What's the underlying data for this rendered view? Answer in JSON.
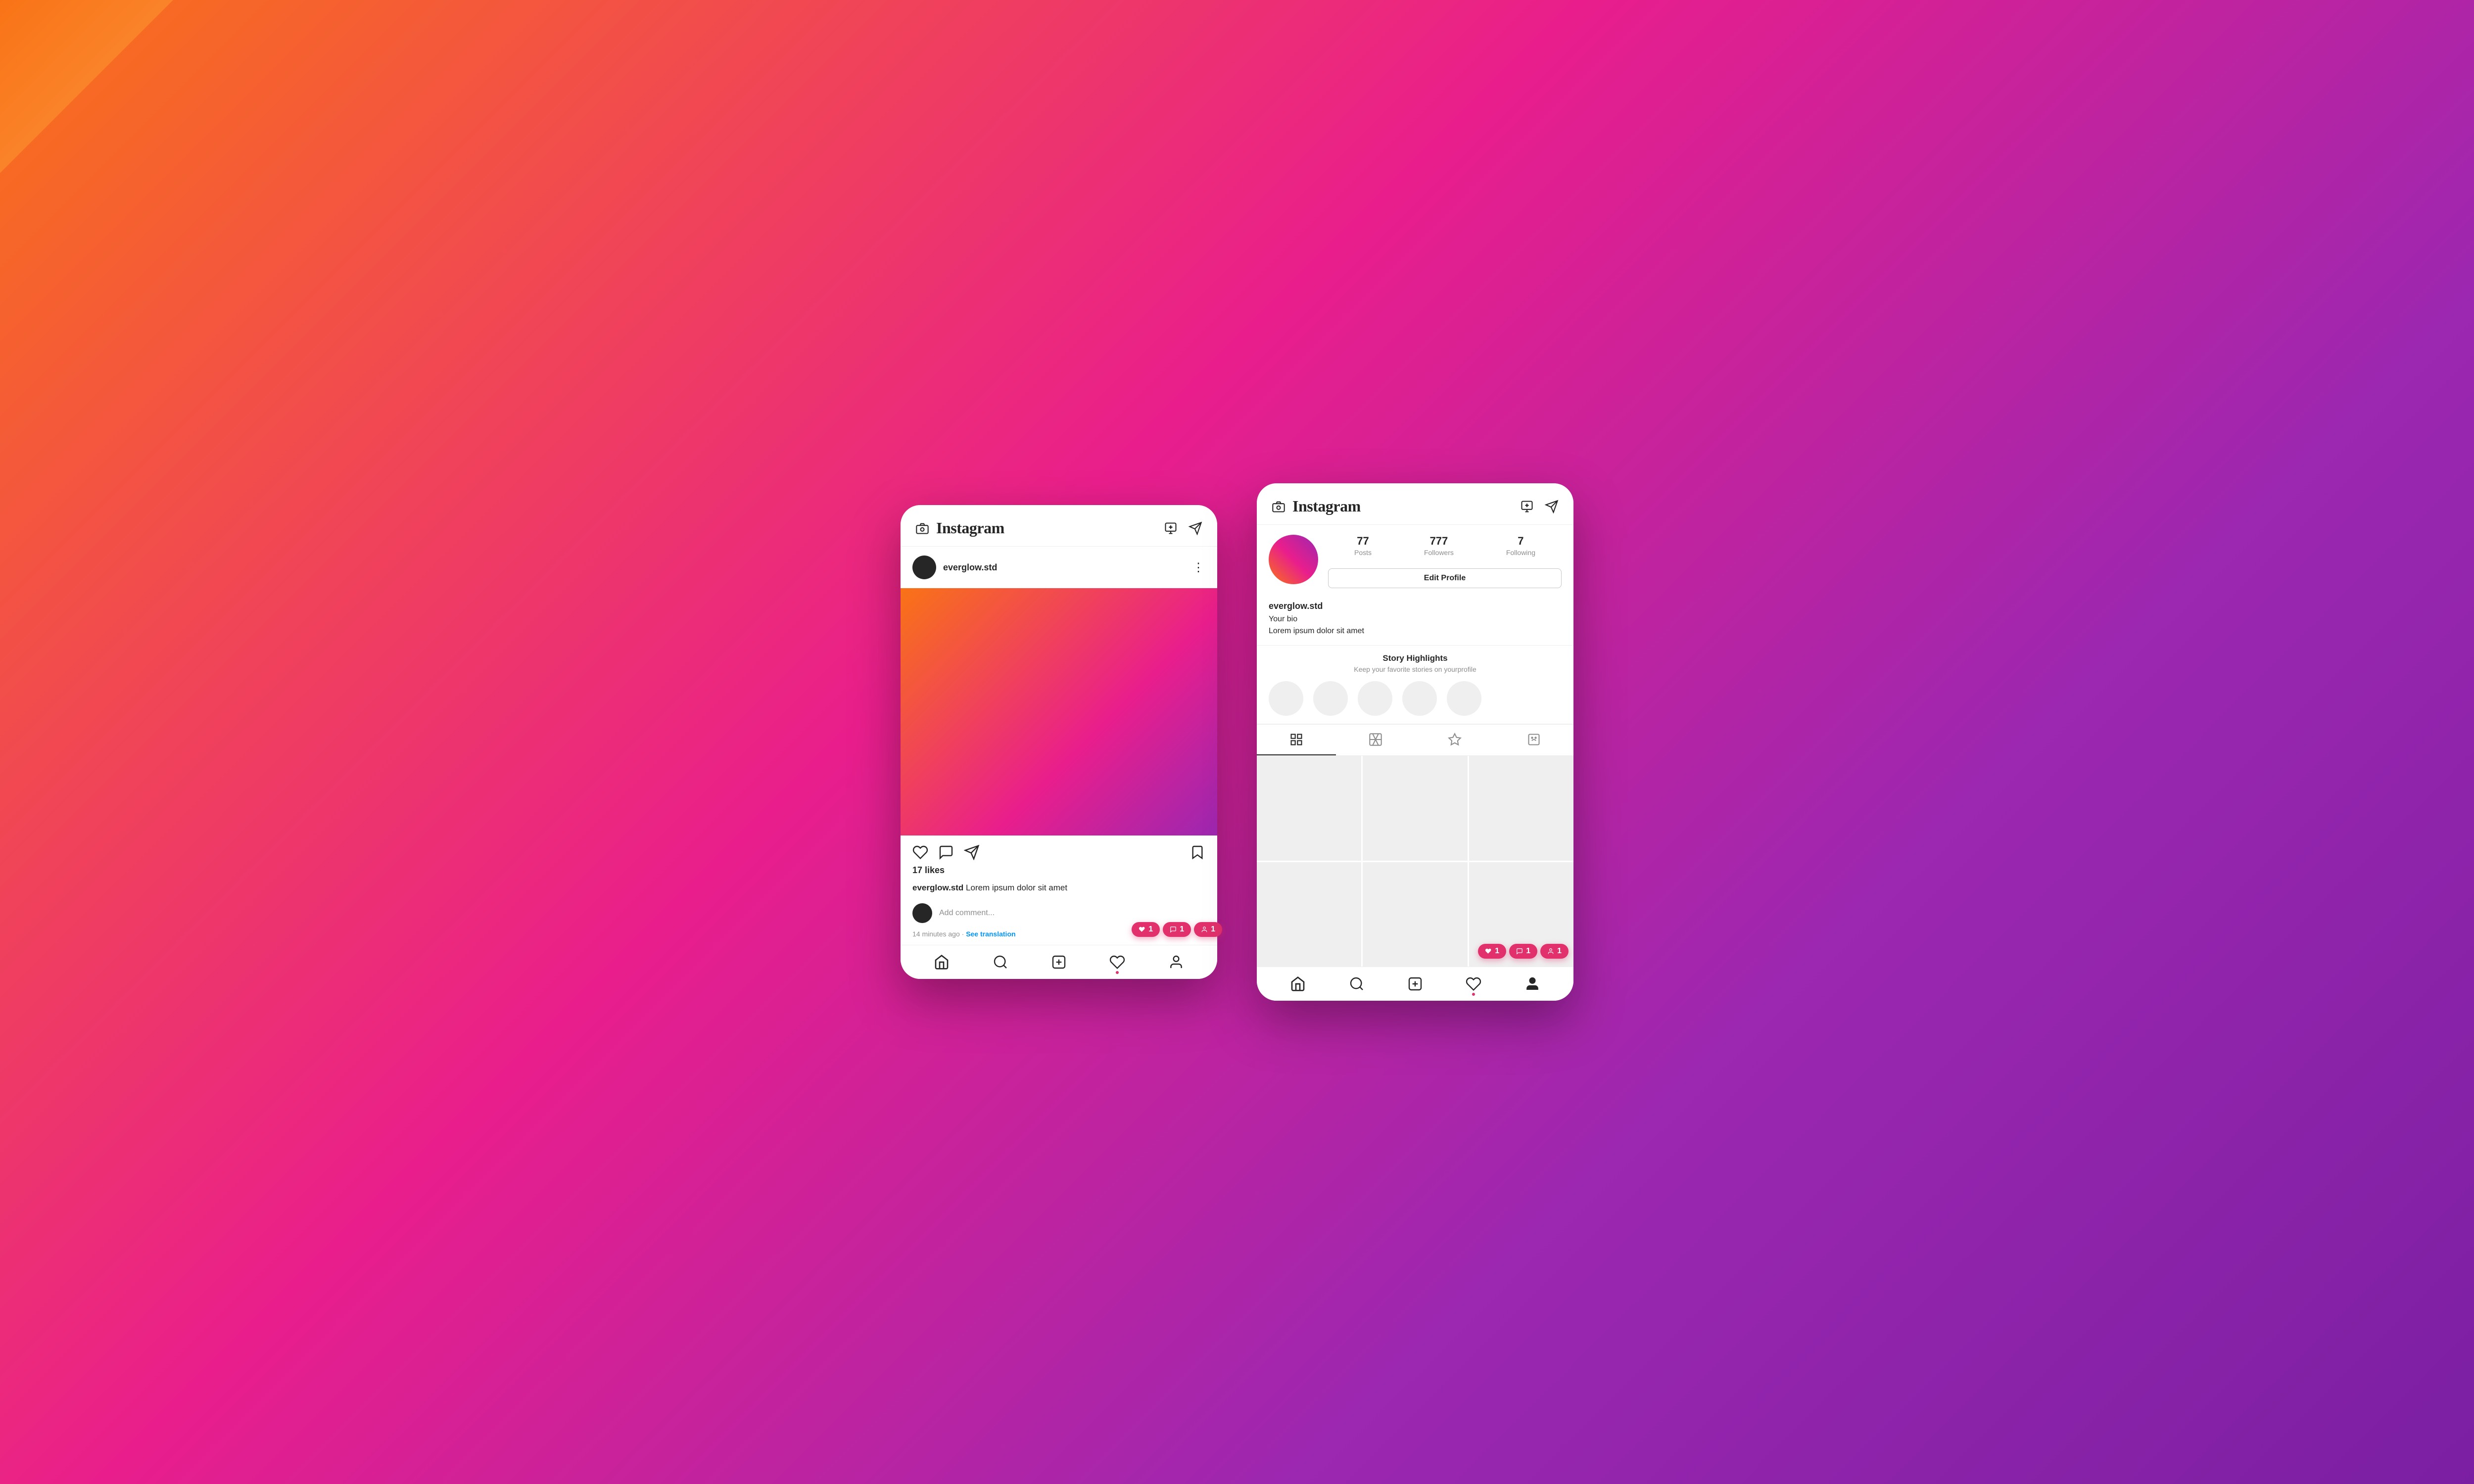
{
  "app": {
    "name": "Instagram"
  },
  "post_phone": {
    "header": {
      "logo": "Instagram",
      "icon_add_story": "➕",
      "icon_messages": "✈"
    },
    "post": {
      "username": "everglow.std",
      "likes": "17 likes",
      "caption_username": "everglow.std",
      "caption_text": " Lorem ipsum dolor sit amet",
      "comment_placeholder": "Add comment...",
      "timestamp": "14 minutes ago ·",
      "see_translation": "See translation"
    },
    "notifications": {
      "heart_count": "1",
      "comment_count": "1",
      "follow_count": "1"
    },
    "nav": {
      "items": [
        "home",
        "search",
        "add",
        "heart",
        "profile"
      ]
    }
  },
  "profile_phone": {
    "header": {
      "logo": "Instagram"
    },
    "profile": {
      "username": "everglow.std",
      "posts_count": "77",
      "posts_label": "Posts",
      "followers_count": "777",
      "followers_label": "Followers",
      "following_count": "7",
      "following_label": "Following",
      "edit_profile_label": "Edit Profile",
      "bio_line1": "Your bio",
      "bio_line2": "Lorem ipsum dolor sit amet"
    },
    "story_highlights": {
      "title": "Story Highlights",
      "subtitle": "Keep your favorite stories on yourprofile"
    },
    "tabs": [
      "grid",
      "reels",
      "tagged",
      "person"
    ],
    "notifications": {
      "heart_count": "1",
      "comment_count": "1",
      "follow_count": "1"
    }
  }
}
